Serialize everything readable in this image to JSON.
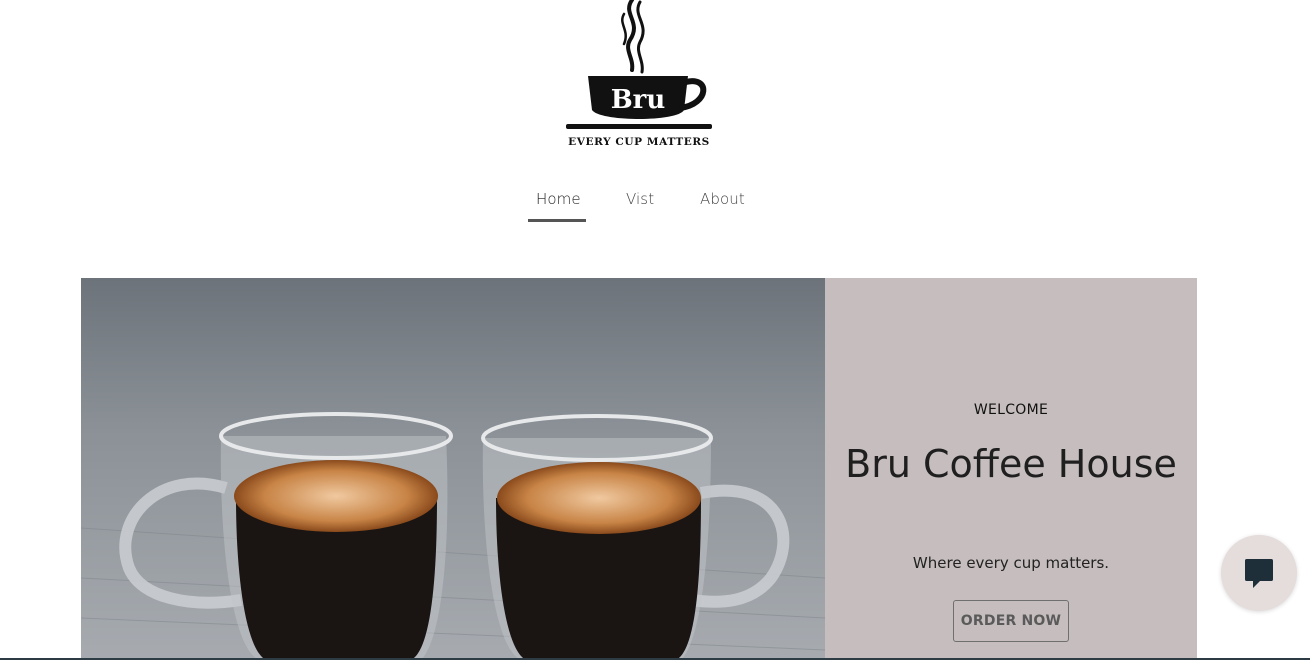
{
  "header": {
    "logo": {
      "brand": "Bru",
      "slogan": "EVERY CUP MATTERS",
      "icon": "coffee-cup-steam-logo"
    }
  },
  "nav": {
    "items": [
      {
        "label": "Home",
        "active": true
      },
      {
        "label": "Vist",
        "active": false
      },
      {
        "label": "About",
        "active": false
      }
    ]
  },
  "hero": {
    "image": {
      "subject": "two glass cups of espresso",
      "icon": "coffee-photo"
    },
    "eyebrow": "WELCOME",
    "title": "Bru Coffee House",
    "subtitle": "Where every cup matters.",
    "cta_label": "ORDER NOW"
  },
  "chat": {
    "icon": "chat-bubble-icon"
  },
  "colors": {
    "panel_bg": "#c6bebe",
    "nav_underline": "#555555",
    "chat_bg": "#e5dcdc",
    "chat_icon": "#1f2f3a"
  }
}
